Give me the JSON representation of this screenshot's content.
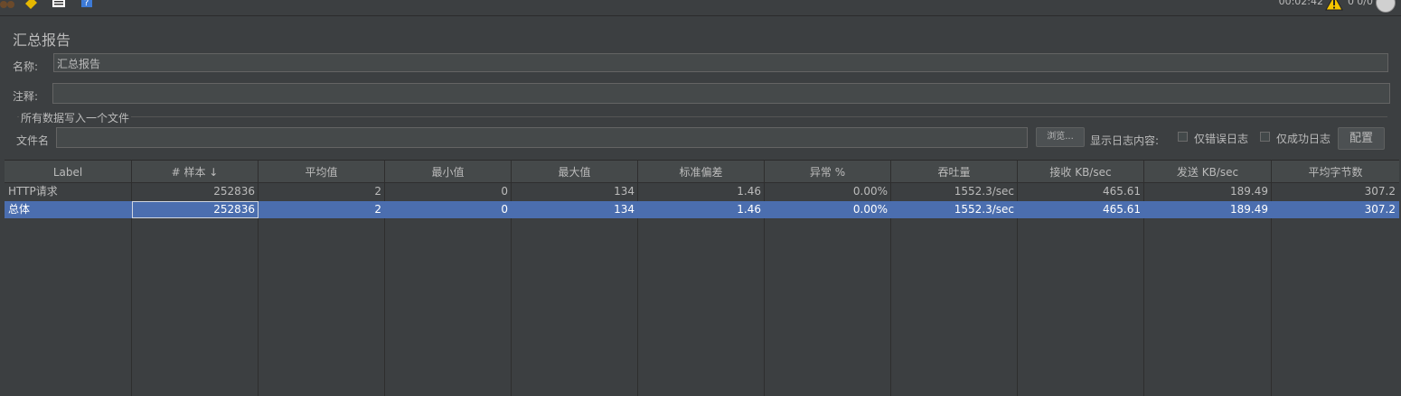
{
  "toolbar": {
    "timer": "00:02:42",
    "warnings": "0",
    "threads": "0/0"
  },
  "report": {
    "title": "汇总报告",
    "name_label": "名称:",
    "name_value": "汇总报告",
    "comment_label": "注释:",
    "comment_value": "",
    "write_all_label": "所有数据写入一个文件",
    "filename_label": "文件名",
    "filename_value": "",
    "browse_button": "浏览...",
    "log_content_label": "显示日志内容:",
    "errors_only_label": "仅错误日志",
    "success_only_label": "仅成功日志",
    "configure_button": "配置"
  },
  "table": {
    "columns": [
      "Label",
      "# 样本 ↓",
      "平均值",
      "最小值",
      "最大值",
      "标准偏差",
      "异常 %",
      "吞吐量",
      "接收 KB/sec",
      "发送 KB/sec",
      "平均字节数"
    ],
    "rows": [
      [
        "HTTP请求",
        "252836",
        "2",
        "0",
        "134",
        "1.46",
        "0.00%",
        "1552.3/sec",
        "465.61",
        "189.49",
        "307.2"
      ],
      [
        "总体",
        "252836",
        "2",
        "0",
        "134",
        "1.46",
        "0.00%",
        "1552.3/sec",
        "465.61",
        "189.49",
        "307.2"
      ]
    ]
  },
  "colors": {
    "background": "#3c3f41",
    "selection": "#4b6eaf"
  }
}
